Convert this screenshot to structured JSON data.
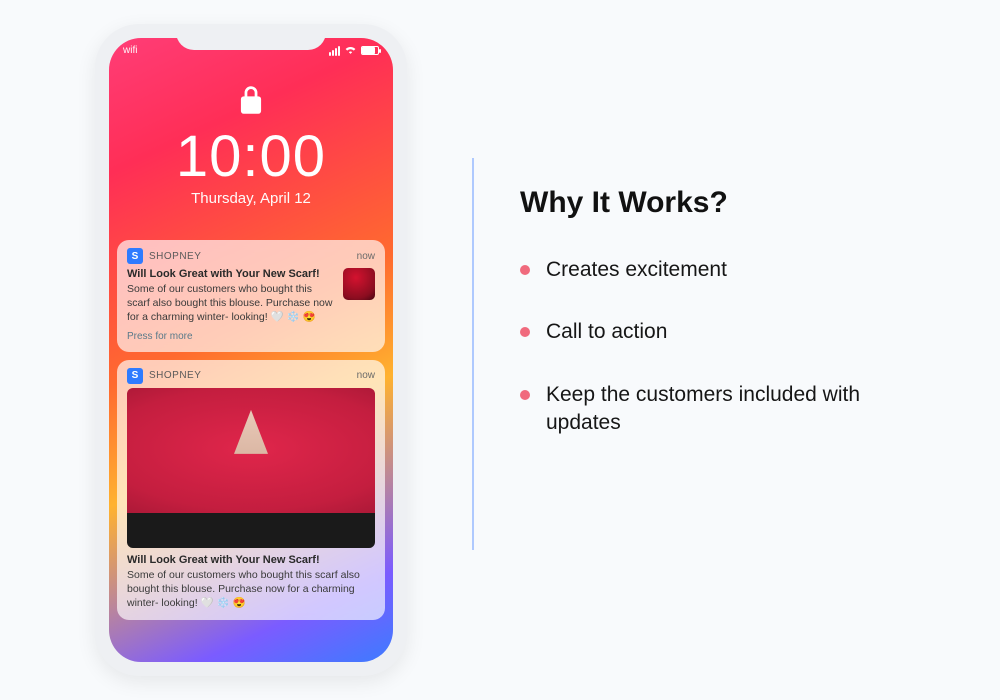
{
  "phone": {
    "status": {
      "left": "wifi"
    },
    "time": "10:00",
    "date": "Thursday, April 12",
    "notifications": [
      {
        "app_initial": "S",
        "app_name": "SHOPNEY",
        "when": "now",
        "title": "Will Look Great with Your New Scarf!",
        "body": "Some of our customers who bought this scarf also bought this blouse. Purchase now for a charming winter- looking! 🤍 ❄️ 😍",
        "press_more": "Press for more"
      },
      {
        "app_initial": "S",
        "app_name": "SHOPNEY",
        "when": "now",
        "title": "Will Look Great with Your New Scarf!",
        "body": "Some of our customers who bought this scarf also bought this blouse. Purchase now for a charming winter- looking! 🤍 ❄️ 😍"
      }
    ]
  },
  "right": {
    "heading": "Why It Works?",
    "bullets": [
      "Creates excitement",
      "Call to action",
      "Keep the customers included with updates"
    ]
  }
}
